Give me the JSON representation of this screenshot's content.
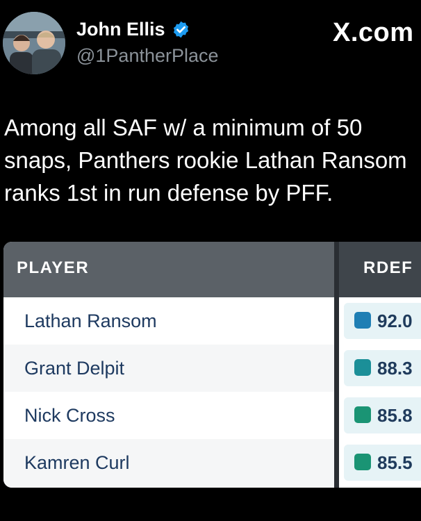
{
  "author": {
    "name": "John Ellis",
    "handle": "@1PantherPlace",
    "verified_color": "#1d9bf0"
  },
  "site": "X.com",
  "tweet": {
    "lines": [
      "Among all SAF w/ a minimum of 50",
      "snaps, Panthers rookie Lathan Ransom",
      "ranks 1st in run defense by PFF."
    ]
  },
  "table": {
    "columns": [
      "PLAYER",
      "RDEF"
    ],
    "rows": [
      {
        "player": "Lathan Ransom",
        "rdef": "92.0",
        "swatch_color": "#1f7fb4"
      },
      {
        "player": "Grant Delpit",
        "rdef": "88.3",
        "swatch_color": "#1b8f98"
      },
      {
        "player": "Nick Cross",
        "rdef": "85.8",
        "swatch_color": "#1a9474"
      },
      {
        "player": "Kamren Curl",
        "rdef": "85.5",
        "swatch_color": "#1a9474"
      }
    ]
  }
}
